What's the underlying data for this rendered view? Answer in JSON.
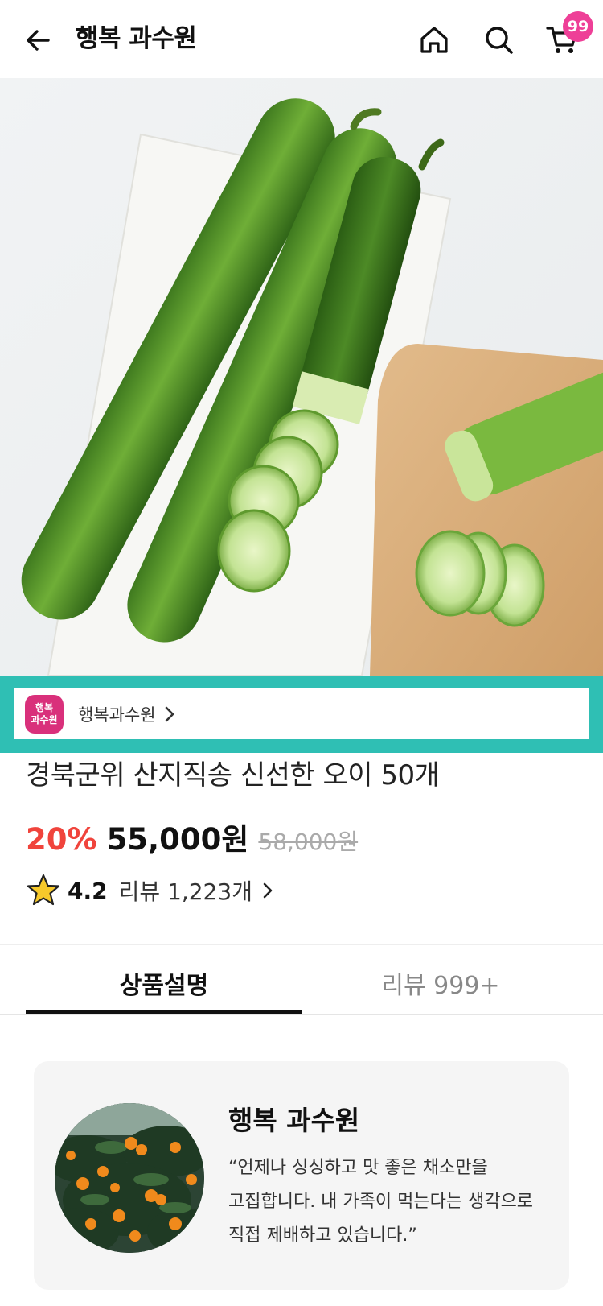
{
  "header": {
    "title": "행복 과수원",
    "cart_badge": "99",
    "icons": [
      "back-arrow-icon",
      "home-icon",
      "search-icon",
      "cart-icon"
    ]
  },
  "seller": {
    "logo_line1": "행복",
    "logo_line2": "과수원",
    "name": "행복과수원",
    "logo_color": "#d9307b",
    "highlight_color": "#2fbfb4"
  },
  "product": {
    "title": "경북군위 산지직송 신선한 오이 50개",
    "discount": "20%",
    "price": "55,000원",
    "original_price": "58,000원",
    "rating": "4.2",
    "review_summary": "리뷰 1,223개"
  },
  "tabs": [
    {
      "label": "상품설명",
      "active": true
    },
    {
      "label": "리뷰 999+",
      "active": false
    }
  ],
  "farm": {
    "name": "행복 과수원",
    "quote_lines": [
      "“언제나 싱싱하고 맛 좋은 채소만을",
      "고집합니다. 내 가족이 먹는다는 생각으로",
      "직접 제배하고 있습니다.”"
    ]
  },
  "colors": {
    "discount": "#f0443c",
    "badge": "#ee3f97",
    "star": "#f7c92b"
  }
}
